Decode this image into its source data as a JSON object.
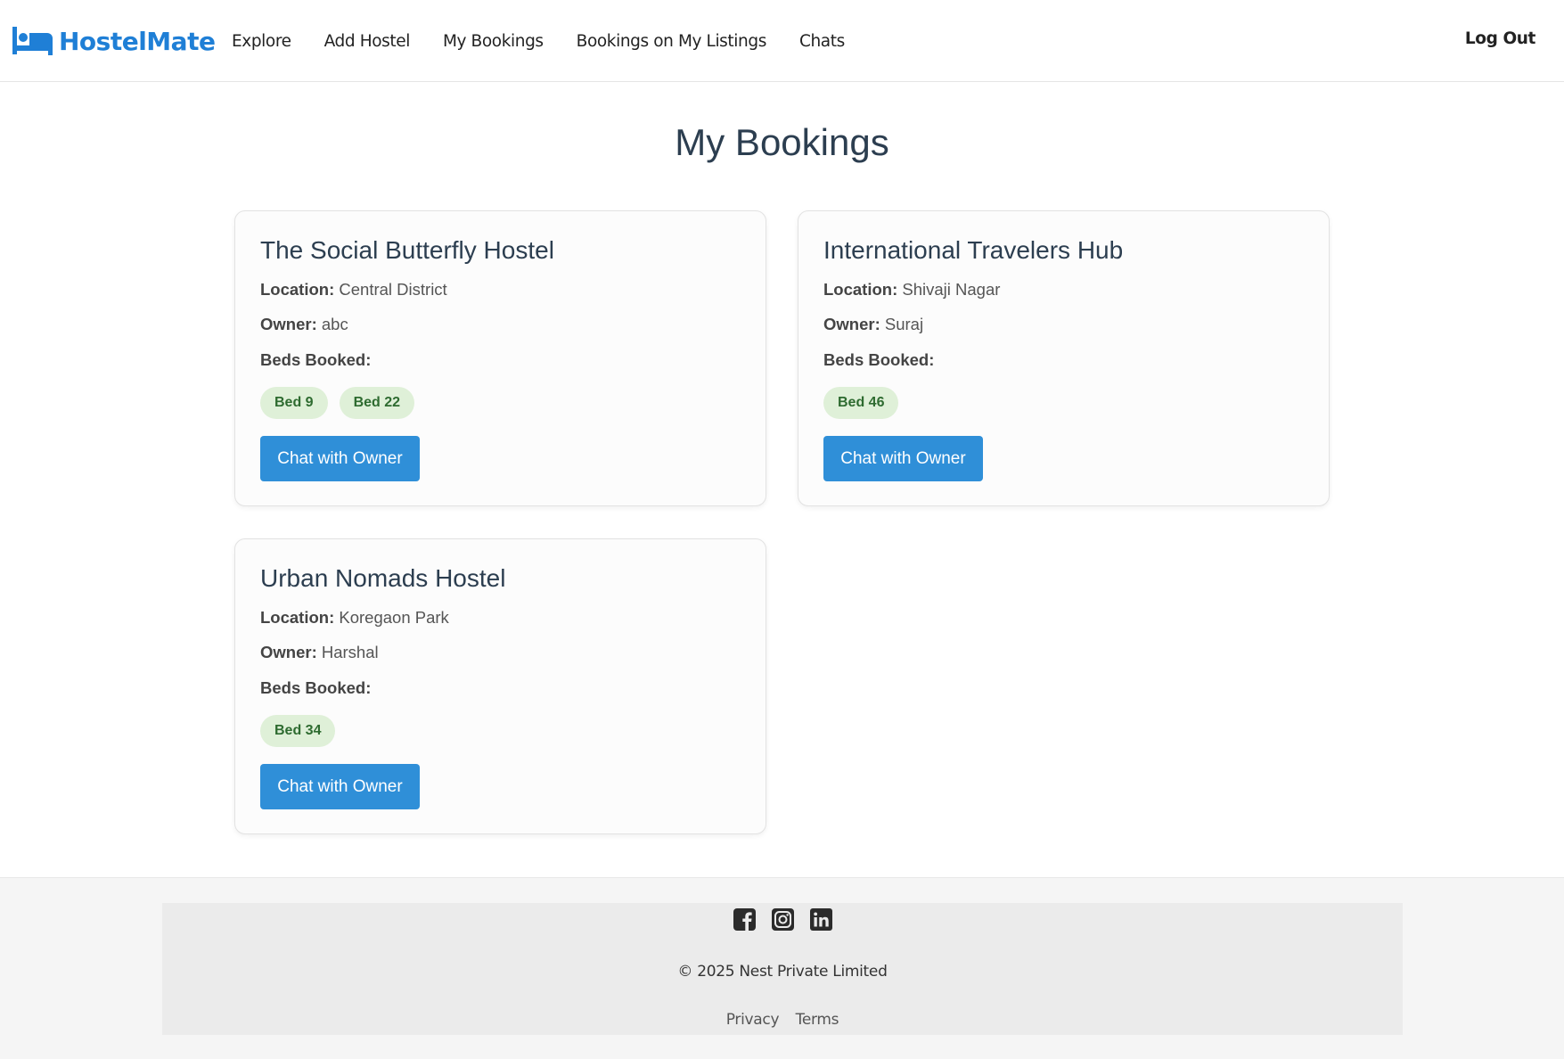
{
  "brand": {
    "name": "HostelMate",
    "color": "#1f7fd6"
  },
  "nav": {
    "links": [
      "Explore",
      "Add Hostel",
      "My Bookings",
      "Bookings on My Listings",
      "Chats"
    ],
    "logout": "Log Out"
  },
  "page": {
    "title": "My Bookings"
  },
  "labels": {
    "location": "Location:",
    "owner": "Owner:",
    "beds_booked": "Beds Booked:"
  },
  "bookings": [
    {
      "name": "The Social Butterfly Hostel",
      "location": "Central District",
      "owner": "abc",
      "beds": [
        "Bed 9",
        "Bed 22"
      ],
      "button": "Chat with Owner"
    },
    {
      "name": "International Travelers Hub",
      "location": "Shivaji Nagar",
      "owner": "Suraj",
      "beds": [
        "Bed 46"
      ],
      "button": "Chat with Owner"
    },
    {
      "name": "Urban Nomads Hostel",
      "location": "Koregaon Park",
      "owner": "Harshal",
      "beds": [
        "Bed 34"
      ],
      "button": "Chat with Owner"
    }
  ],
  "footer": {
    "social_icons": [
      "facebook-icon",
      "instagram-icon",
      "linkedin-icon"
    ],
    "copyright": "© 2025 Nest Private Limited",
    "links": [
      "Privacy",
      "Terms"
    ]
  },
  "colors": {
    "accent": "#2f8fd8",
    "chip_bg": "#dff0d8",
    "chip_text": "#2e6b30",
    "title": "#2c3e50"
  }
}
